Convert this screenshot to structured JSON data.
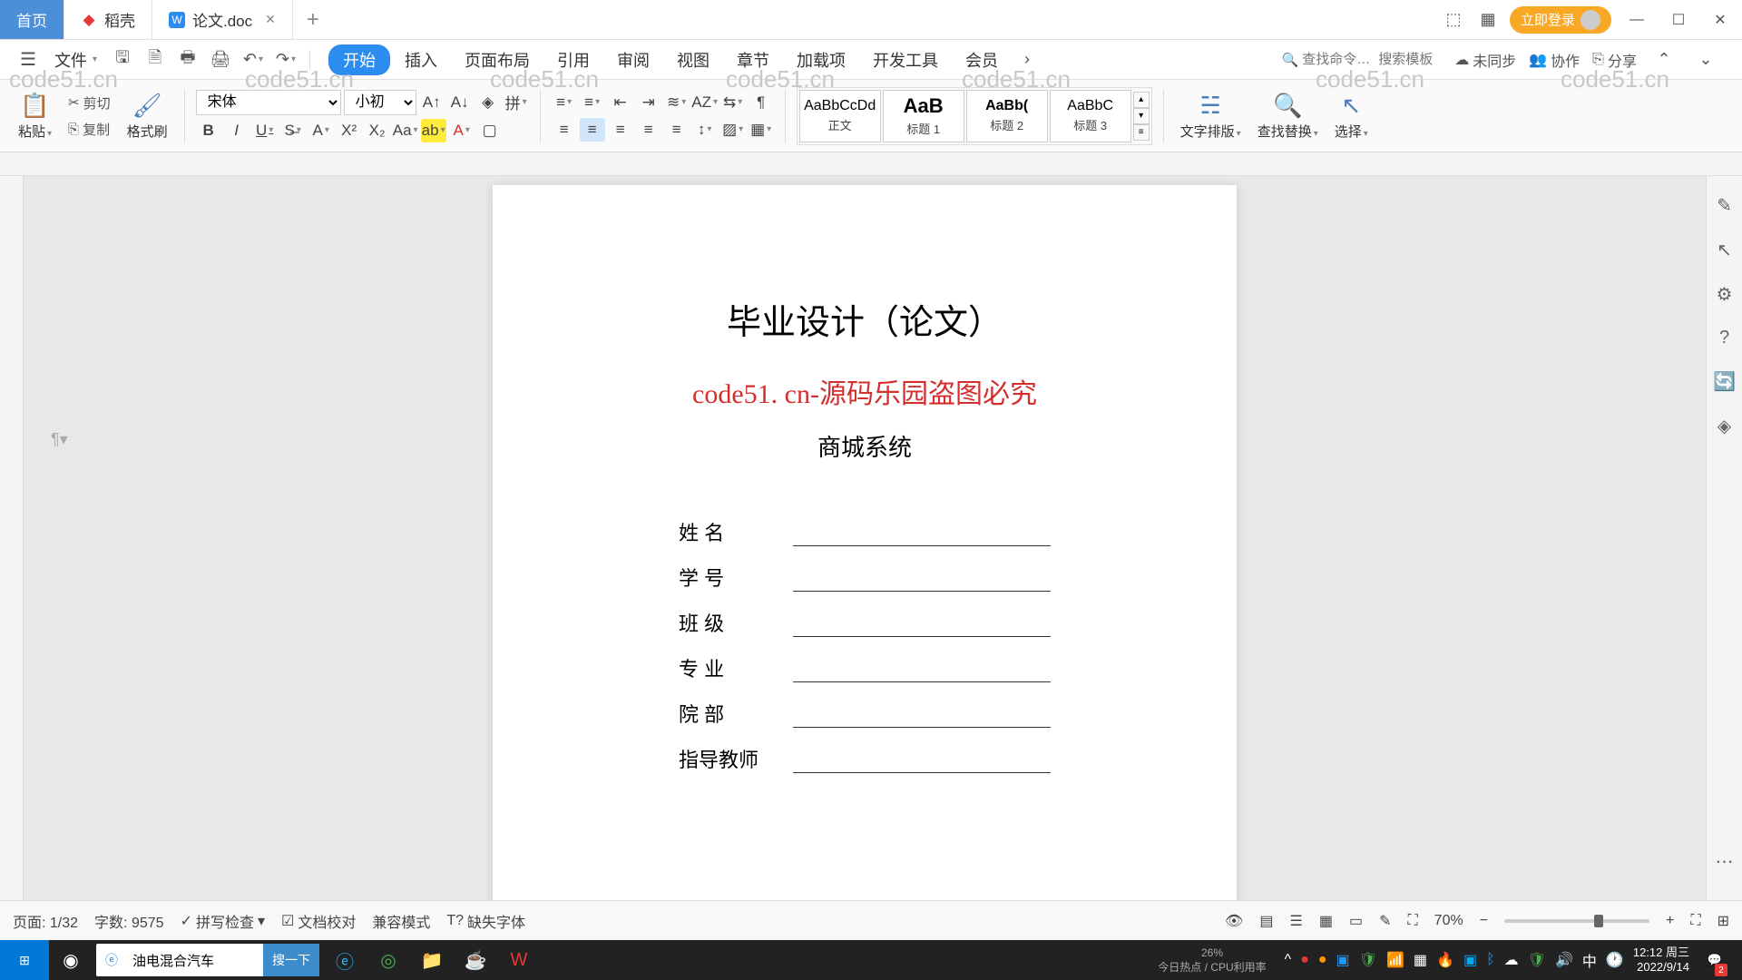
{
  "tabs": {
    "home": "首页",
    "docer": "稻壳",
    "doc": "论文.doc"
  },
  "titlebar": {
    "login": "立即登录"
  },
  "menubar": {
    "file": "文件",
    "search_cmd_ph": "查找命令…",
    "search_tpl_ph": "搜索模板",
    "unsync": "未同步",
    "collab": "协作",
    "share": "分享"
  },
  "ribbon_tabs": [
    "开始",
    "插入",
    "页面布局",
    "引用",
    "审阅",
    "视图",
    "章节",
    "加载项",
    "开发工具",
    "会员"
  ],
  "ribbon": {
    "paste": "粘贴",
    "cut": "剪切",
    "copy": "复制",
    "format_painter": "格式刷",
    "font": "宋体",
    "size": "小初",
    "styles": {
      "body": {
        "preview": "AaBbCcDd",
        "label": "正文"
      },
      "h1": {
        "preview": "AaB",
        "label": "标题 1"
      },
      "h2": {
        "preview": "AaBb(",
        "label": "标题 2"
      },
      "h3": {
        "preview": "AaBbC",
        "label": "标题 3"
      }
    },
    "text_layout": "文字排版",
    "find_replace": "查找替换",
    "select": "选择"
  },
  "document": {
    "title": "毕业设计（论文）",
    "watermark_line": "code51. cn-源码乐园盗图必究",
    "subtitle": "商城系统",
    "fields": [
      "姓 名",
      "学 号",
      "班 级",
      "专 业",
      "院 部",
      "指导教师"
    ]
  },
  "watermark_text": "code51.cn",
  "statusbar": {
    "page": "页面: 1/32",
    "words": "字数: 9575",
    "spell": "拼写检查",
    "proof": "文档校对",
    "compat": "兼容模式",
    "missing_font": "缺失字体",
    "zoom": "70%"
  },
  "os": {
    "search_text": "油电混合汽车",
    "search_btn": "搜一下",
    "hot": "今日热点",
    "cpu": "CPU利用率",
    "pct": "26%",
    "ime": "中",
    "time": "12:12 周三",
    "date": "2022/9/14",
    "notif_count": "2"
  }
}
